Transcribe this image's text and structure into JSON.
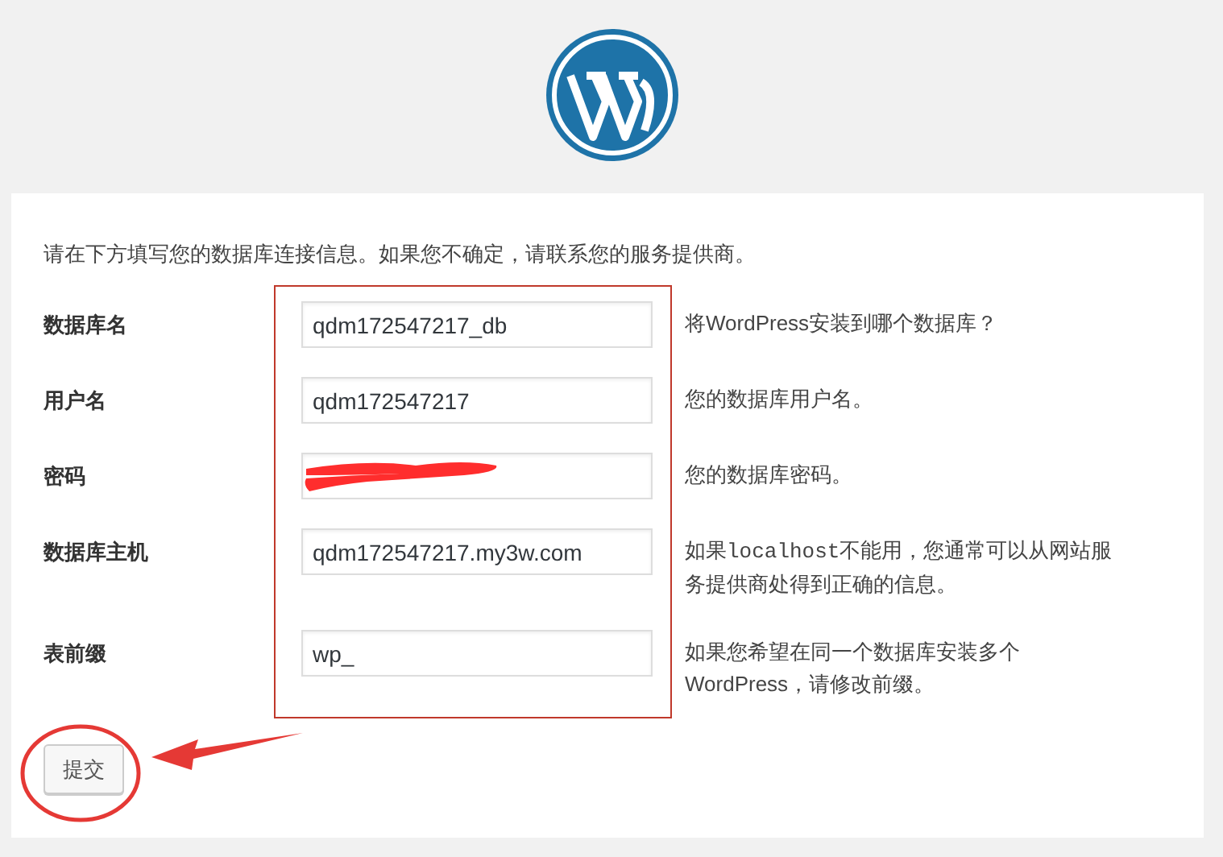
{
  "intro": "请在下方填写您的数据库连接信息。如果您不确定，请联系您的服务提供商。",
  "fields": [
    {
      "label": "数据库名",
      "value": "qdm172547217_db",
      "redacted": false,
      "help": [
        {
          "text": "将WordPress安装到哪个数据库？",
          "code": false
        }
      ]
    },
    {
      "label": "用户名",
      "value": "qdm172547217",
      "redacted": false,
      "help": [
        {
          "text": "您的数据库用户名。",
          "code": false
        }
      ]
    },
    {
      "label": "密码",
      "redacted": true,
      "help": [
        {
          "text": "您的数据库密码。",
          "code": false
        }
      ]
    },
    {
      "label": "数据库主机",
      "value": "qdm172547217.my3w.com",
      "redacted": false,
      "help": [
        {
          "text": "如果",
          "code": false
        },
        {
          "text": "localhost",
          "code": true
        },
        {
          "text": "不能用，您通常可以从网站服务提供商处得到正确的信息。",
          "code": false
        }
      ]
    },
    {
      "label": "表前缀",
      "value": "wp_",
      "redacted": false,
      "help": [
        {
          "text": "如果您希望在同一个数据库安装多个WordPress，请修改前缀。",
          "code": false
        }
      ]
    }
  ],
  "submit": "提交"
}
